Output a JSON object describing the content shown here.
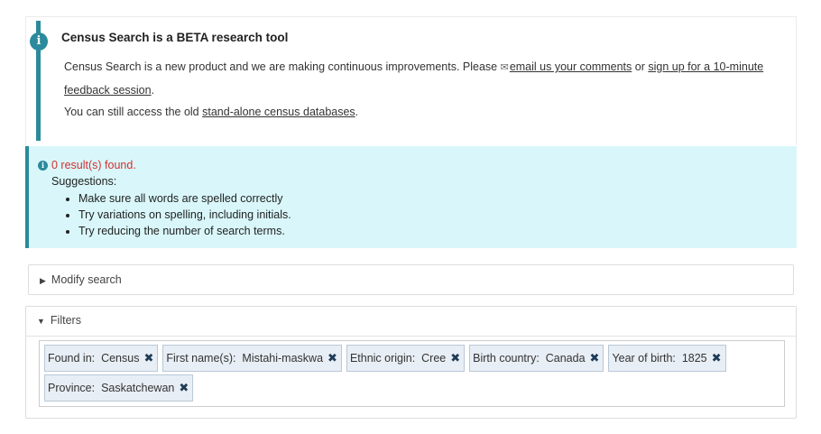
{
  "beta": {
    "title": "Census Search is a BETA research tool",
    "line1_text": "Census Search is a new product and we are making continuous improvements. Please ",
    "email_link": "email us your comments",
    "or_text": " or ",
    "signup_link": "sign up for a 10-minute feedback session",
    "line1_end": ".",
    "line2_text": "You can still access the old ",
    "old_db_link": "stand-alone census databases",
    "line2_end": "."
  },
  "results": {
    "found_text": "0 result(s) found.",
    "suggestions_title": "Suggestions:",
    "suggestions": [
      "Make sure all words are spelled correctly",
      "Try variations on spelling, including initials.",
      "Try reducing the number of search terms."
    ]
  },
  "modify_search": {
    "label": "Modify search"
  },
  "filters": {
    "label": "Filters",
    "chips": [
      {
        "label": "Found in:",
        "value": "Census"
      },
      {
        "label": "First name(s):",
        "value": "Mistahi-maskwa"
      },
      {
        "label": "Ethnic origin:",
        "value": "Cree"
      },
      {
        "label": "Birth country:",
        "value": "Canada"
      },
      {
        "label": "Year of birth:",
        "value": "1825"
      },
      {
        "label": "Province:",
        "value": "Saskatchewan"
      }
    ]
  },
  "icons": {
    "info": "i",
    "envelope": "✉",
    "remove": "✖",
    "collapsed": "▶",
    "expanded": "▼"
  },
  "colors": {
    "accent": "#2b8a9c",
    "results_bg": "#d9f7fa",
    "error_text": "#d3302f"
  }
}
